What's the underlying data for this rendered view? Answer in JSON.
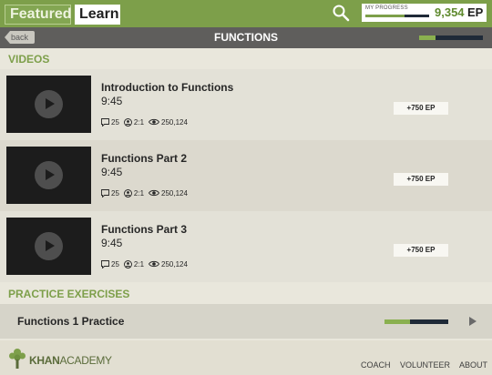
{
  "header": {
    "tabs": [
      {
        "label": "Featured",
        "active": false
      },
      {
        "label": "Learn",
        "active": true
      }
    ],
    "search_icon": "search-icon",
    "progress": {
      "label": "MY PROGRESS",
      "value": "9,354",
      "unit": "EP",
      "fraction": 0.62
    }
  },
  "titlebar": {
    "back_label": "back",
    "title": "FUNCTIONS",
    "progress_fraction": 0.25
  },
  "videos": {
    "header": "VIDEOS",
    "items": [
      {
        "title": "Introduction to Functions",
        "duration": "9:45",
        "comments": "25",
        "ratio": "2:1",
        "views": "250,124",
        "ep": "+750",
        "ep_unit": "EP"
      },
      {
        "title": "Functions Part 2",
        "duration": "9:45",
        "comments": "25",
        "ratio": "2:1",
        "views": "250,124",
        "ep": "+750",
        "ep_unit": "EP"
      },
      {
        "title": "Functions Part 3",
        "duration": "9:45",
        "comments": "25",
        "ratio": "2:1",
        "views": "250,124",
        "ep": "+750",
        "ep_unit": "EP"
      }
    ]
  },
  "practice": {
    "header": "PRACTICE EXERCISES",
    "items": [
      {
        "name": "Functions 1 Practice",
        "progress_fraction": 0.4
      }
    ]
  },
  "footer": {
    "logo_strong": "KHAN",
    "logo_light": "ACADEMY",
    "links": [
      "COACH",
      "VOLUNTEER",
      "ABOUT"
    ]
  },
  "colors": {
    "brand_green": "#7d9f4a",
    "titlebar_gray": "#5f5e5c",
    "progress_navy": "#1f2a38"
  }
}
